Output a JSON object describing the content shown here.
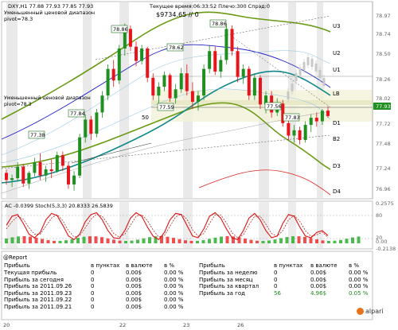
{
  "window": {
    "symbol_line": "DXY,H1  77.88 77.93 77.85 77.93",
    "subtitle_1": "Уменьшенный ценовой диапазон",
    "subtitle_2": "pivot=78.3",
    "info_1": "Текущее время:06:33:52 Плечо:300 Спрэд:0",
    "info_2": "$9734.65  // 0",
    "left_note_1": "Уменьшенный ценовой диапазон",
    "left_note_2": "pivot=78.3"
  },
  "chart_data": [
    {
      "type": "candlestick",
      "title": "DXY,H1  77.88 77.93 77.85 77.93",
      "ylim": [
        76.96,
        79.0
      ],
      "y_ticks": [
        "78.97",
        "78.74",
        "78.50",
        "78.26",
        "78.02",
        "77.93",
        "77.72",
        "77.48",
        "77.24",
        "76.96"
      ],
      "current_price": "77.93",
      "level_labels": [
        "U3",
        "U2",
        "U1",
        "LB",
        "D1",
        "B2",
        "D3",
        "D4"
      ],
      "price_tags": [
        "78.86",
        "78.86",
        "78.62",
        "77.84",
        "77.59",
        "77.38",
        "77.56",
        "77.83"
      ],
      "annotation": "50",
      "x_ticks": [
        "20",
        "22",
        "23",
        "26"
      ],
      "candles": [
        {
          "o": 77.18,
          "h": 77.22,
          "l": 77.05,
          "c": 77.1
        },
        {
          "o": 77.1,
          "h": 77.16,
          "l": 77.02,
          "c": 77.12
        },
        {
          "o": 77.12,
          "h": 77.3,
          "l": 77.08,
          "c": 77.25
        },
        {
          "o": 77.25,
          "h": 77.28,
          "l": 77.02,
          "c": 77.06
        },
        {
          "o": 77.06,
          "h": 77.2,
          "l": 77.0,
          "c": 77.18
        },
        {
          "o": 77.18,
          "h": 77.35,
          "l": 77.14,
          "c": 77.3
        },
        {
          "o": 77.3,
          "h": 77.4,
          "l": 77.1,
          "c": 77.15
        },
        {
          "o": 77.15,
          "h": 77.26,
          "l": 77.08,
          "c": 77.22
        },
        {
          "o": 77.22,
          "h": 77.33,
          "l": 77.12,
          "c": 77.2
        },
        {
          "o": 77.2,
          "h": 77.42,
          "l": 77.18,
          "c": 77.38
        },
        {
          "o": 77.38,
          "h": 77.42,
          "l": 77.2,
          "c": 77.26
        },
        {
          "o": 77.26,
          "h": 77.3,
          "l": 77.0,
          "c": 77.05
        },
        {
          "o": 77.05,
          "h": 77.2,
          "l": 76.98,
          "c": 77.15
        },
        {
          "o": 77.15,
          "h": 77.62,
          "l": 77.12,
          "c": 77.58
        },
        {
          "o": 77.58,
          "h": 77.84,
          "l": 77.52,
          "c": 77.78
        },
        {
          "o": 77.78,
          "h": 77.82,
          "l": 77.55,
          "c": 77.62
        },
        {
          "o": 77.62,
          "h": 77.9,
          "l": 77.58,
          "c": 77.86
        },
        {
          "o": 77.86,
          "h": 78.1,
          "l": 77.8,
          "c": 78.05
        },
        {
          "o": 78.05,
          "h": 78.4,
          "l": 78.0,
          "c": 78.35
        },
        {
          "o": 78.35,
          "h": 78.45,
          "l": 78.15,
          "c": 78.22
        },
        {
          "o": 78.22,
          "h": 78.62,
          "l": 78.18,
          "c": 78.58
        },
        {
          "o": 78.58,
          "h": 78.86,
          "l": 78.5,
          "c": 78.8
        },
        {
          "o": 78.8,
          "h": 78.84,
          "l": 78.55,
          "c": 78.6
        },
        {
          "o": 78.6,
          "h": 78.66,
          "l": 78.38,
          "c": 78.44
        },
        {
          "o": 78.44,
          "h": 78.62,
          "l": 78.4,
          "c": 78.58
        },
        {
          "o": 78.58,
          "h": 78.6,
          "l": 78.2,
          "c": 78.25
        },
        {
          "o": 78.25,
          "h": 78.3,
          "l": 78.0,
          "c": 78.05
        },
        {
          "o": 78.05,
          "h": 78.2,
          "l": 77.95,
          "c": 78.15
        },
        {
          "o": 78.15,
          "h": 78.32,
          "l": 78.1,
          "c": 78.28
        },
        {
          "o": 78.28,
          "h": 78.3,
          "l": 77.98,
          "c": 78.02
        },
        {
          "o": 78.02,
          "h": 78.18,
          "l": 77.96,
          "c": 78.12
        },
        {
          "o": 78.12,
          "h": 78.36,
          "l": 78.08,
          "c": 78.3
        },
        {
          "o": 78.3,
          "h": 78.4,
          "l": 78.05,
          "c": 78.1
        },
        {
          "o": 78.1,
          "h": 78.2,
          "l": 77.9,
          "c": 77.98
        },
        {
          "o": 77.98,
          "h": 78.1,
          "l": 77.88,
          "c": 78.05
        },
        {
          "o": 78.05,
          "h": 78.4,
          "l": 78.0,
          "c": 78.35
        },
        {
          "o": 78.35,
          "h": 78.62,
          "l": 78.3,
          "c": 78.55
        },
        {
          "o": 78.55,
          "h": 78.6,
          "l": 78.28,
          "c": 78.32
        },
        {
          "o": 78.32,
          "h": 78.5,
          "l": 78.25,
          "c": 78.45
        },
        {
          "o": 78.45,
          "h": 78.86,
          "l": 78.4,
          "c": 78.8
        },
        {
          "o": 78.8,
          "h": 78.84,
          "l": 78.5,
          "c": 78.55
        },
        {
          "o": 78.55,
          "h": 78.6,
          "l": 78.2,
          "c": 78.26
        },
        {
          "o": 78.26,
          "h": 78.4,
          "l": 78.18,
          "c": 78.35
        },
        {
          "o": 78.35,
          "h": 78.38,
          "l": 78.0,
          "c": 78.05
        },
        {
          "o": 78.05,
          "h": 78.3,
          "l": 78.0,
          "c": 78.25
        },
        {
          "o": 78.25,
          "h": 78.28,
          "l": 77.9,
          "c": 77.95
        },
        {
          "o": 77.95,
          "h": 78.1,
          "l": 77.85,
          "c": 78.05
        },
        {
          "o": 78.05,
          "h": 78.1,
          "l": 77.8,
          "c": 77.86
        },
        {
          "o": 77.86,
          "h": 78.02,
          "l": 77.82,
          "c": 77.96
        },
        {
          "o": 77.96,
          "h": 78.0,
          "l": 77.7,
          "c": 77.74
        },
        {
          "o": 77.74,
          "h": 77.8,
          "l": 77.55,
          "c": 77.6
        },
        {
          "o": 77.6,
          "h": 77.72,
          "l": 77.52,
          "c": 77.66
        },
        {
          "o": 77.66,
          "h": 77.7,
          "l": 77.5,
          "c": 77.55
        },
        {
          "o": 77.55,
          "h": 77.76,
          "l": 77.52,
          "c": 77.72
        },
        {
          "o": 77.72,
          "h": 77.84,
          "l": 77.64,
          "c": 77.8
        },
        {
          "o": 77.8,
          "h": 77.86,
          "l": 77.7,
          "c": 77.76
        },
        {
          "o": 77.76,
          "h": 77.9,
          "l": 77.72,
          "c": 77.88
        },
        {
          "o": 77.88,
          "h": 77.93,
          "l": 77.8,
          "c": 77.82
        }
      ]
    },
    {
      "type": "line",
      "title": "AC -0.0399  Stoch(5,3,3) 20.8333 26.5839",
      "y_ticks": [
        "0.2575",
        "80",
        "20",
        "0.00",
        "-0.2138"
      ],
      "ylim": [
        0,
        100
      ],
      "series": [
        {
          "values": [
            55,
            80,
            85,
            60,
            30,
            20,
            35,
            70,
            88,
            82,
            55,
            25,
            15,
            30,
            65,
            85,
            90,
            70,
            40,
            20,
            18,
            40,
            75,
            90,
            80,
            50,
            25,
            15,
            35,
            70,
            88,
            85,
            55,
            25,
            20,
            45,
            80,
            90,
            75,
            45,
            20,
            15,
            40,
            75,
            88,
            70,
            40,
            20,
            25,
            60,
            85,
            80,
            50,
            25,
            20,
            35,
            40,
            26
          ]
        },
        {
          "values": [
            45,
            65,
            80,
            72,
            48,
            30,
            30,
            52,
            75,
            85,
            68,
            40,
            22,
            25,
            48,
            72,
            86,
            80,
            58,
            32,
            22,
            30,
            55,
            80,
            85,
            68,
            42,
            22,
            26,
            52,
            78,
            86,
            72,
            42,
            24,
            32,
            60,
            84,
            84,
            62,
            34,
            20,
            28,
            56,
            80,
            80,
            58,
            32,
            24,
            40,
            70,
            82,
            66,
            40,
            24,
            28,
            36,
            21
          ]
        }
      ]
    }
  ],
  "indicator": {
    "label": "AC -0.0399  Stoch(5,3,3) 20.8333 26.5839"
  },
  "report": {
    "title": "@Report",
    "col_headers_left": [
      "Прибыль",
      "в пунктах",
      "в валюте",
      "в %"
    ],
    "col_headers_right": [
      "Прибыль",
      "в пунктах",
      "в валюте",
      "в %"
    ],
    "rows_left": [
      [
        "Текущая прибыль",
        "0",
        "0.00$",
        "0.00 %"
      ],
      [
        "Прибыль за сегодня",
        "0",
        "0.00$",
        "0.00 %"
      ],
      [
        "Прибыль за 2011.09.26",
        "0",
        "0.00$",
        "0.00 %"
      ],
      [
        "Прибыль за 2011.09.23",
        "0",
        "0.00$",
        "0.00 %"
      ],
      [
        "Прибыль за 2011.09.22",
        "0",
        "0.00$",
        "0.00 %"
      ],
      [
        "Прибыль за 2011.09.21",
        "0",
        "0.00$",
        "0.00 %"
      ]
    ],
    "rows_right": [
      [
        "Прибыль за неделю",
        "0",
        "0.00$",
        "0.00 %"
      ],
      [
        "Прибыль за месяц",
        "0",
        "0.00$",
        "0.00 %"
      ],
      [
        "Прибыль за квартал",
        "0",
        "0.00$",
        "0.00 %"
      ],
      [
        "Прибыль за год",
        "56",
        "4.96$",
        "0.05 %"
      ]
    ]
  },
  "brand": "alpari",
  "colors": {
    "bull": "#1f8f1f",
    "bear": "#e8141c",
    "ma_blue": "#2222cc",
    "ma_teal": "#118888",
    "band_olive": "#6a9a14",
    "stoch_red": "#dd1111",
    "price_tag": "#1a6e1a"
  }
}
